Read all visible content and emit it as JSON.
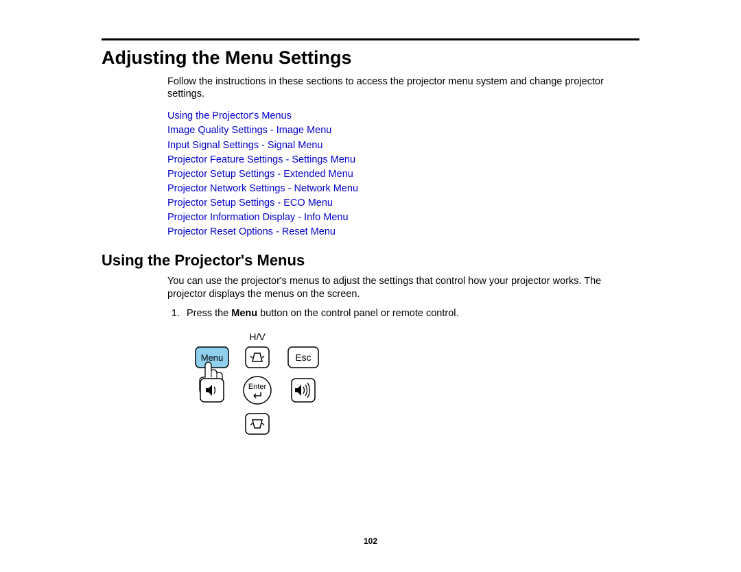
{
  "heading": "Adjusting the Menu Settings",
  "intro": "Follow the instructions in these sections to access the projector menu system and change projector settings.",
  "links": [
    "Using the Projector's Menus",
    "Image Quality Settings - Image Menu",
    "Input Signal Settings - Signal Menu",
    "Projector Feature Settings - Settings Menu",
    "Projector Setup Settings - Extended Menu",
    "Projector Network Settings - Network Menu",
    "Projector Setup Settings - ECO Menu",
    "Projector Information Display - Info Menu",
    "Projector Reset Options - Reset Menu"
  ],
  "subheading": "Using the Projector's Menus",
  "sub_intro": "You can use the projector's menus to adjust the settings that control how your projector works. The projector displays the menus on the screen.",
  "step1_pre": "Press the ",
  "step1_bold": "Menu",
  "step1_post": " button on the control panel or remote control.",
  "figure": {
    "hv_label": "H/V",
    "menu_label": "Menu",
    "esc_label": "Esc",
    "enter_label": "Enter"
  },
  "page_number": "102"
}
